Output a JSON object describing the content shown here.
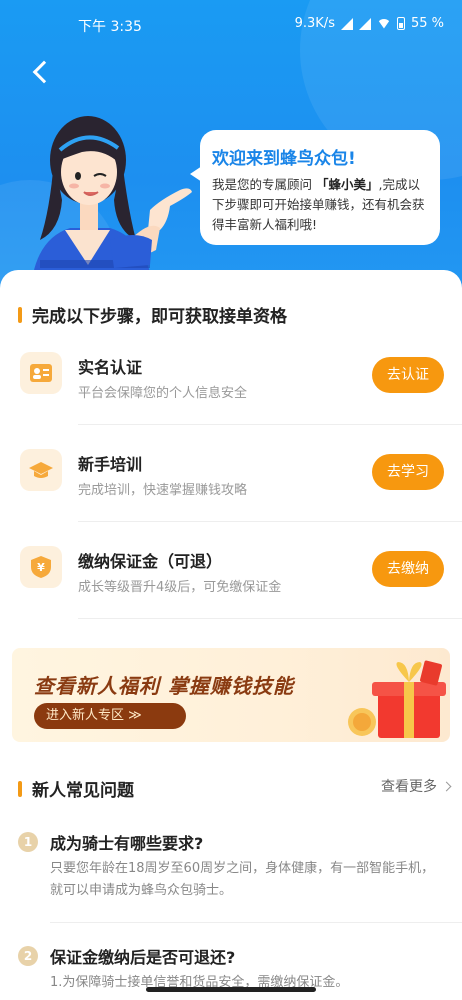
{
  "status_bar": {
    "time": "下午 3:35",
    "net_speed": "9.3K/s",
    "battery": "55 %"
  },
  "welcome": {
    "title": "欢迎来到蜂鸟众包!",
    "line_pre": "我是您的专属顾问 ",
    "advisor": "「蜂小美」",
    "line_post": ",完成以下步骤即可开始接单赚钱，还有机会获得丰富新人福利哦!"
  },
  "steps_section": {
    "title": "完成以下步骤，即可获取接单资格",
    "steps": [
      {
        "name": "实名认证",
        "desc": "平台会保障您的个人信息安全",
        "button": "去认证",
        "icon": "id-card-icon"
      },
      {
        "name": "新手培训",
        "desc": "完成培训，快速掌握赚钱攻略",
        "button": "去学习",
        "icon": "graduation-cap-icon"
      },
      {
        "name": "缴纳保证金（可退）",
        "desc": "成长等级晋升4级后，可免缴保证金",
        "button": "去缴纳",
        "icon": "yuan-shield-icon"
      }
    ]
  },
  "banner": {
    "title": "查看新人福利 掌握赚钱技能",
    "button": "进入新人专区 ≫"
  },
  "faq_section": {
    "title": "新人常见问题",
    "more": "查看更多",
    "items": [
      {
        "num": "1",
        "question": "成为骑士有哪些要求?",
        "answer": "只要您年龄在18周岁至60周岁之间，身体健康，有一部智能手机，就可以申请成为蜂鸟众包骑士。"
      },
      {
        "num": "2",
        "question": "保证金缴纳后是否可退还?",
        "answer": "1.为保障骑士接单信誉和货品安全，需缴纳保证金。"
      }
    ]
  },
  "colors": {
    "hero_blue": "#1d8ff0",
    "accent_orange": "#f7980f",
    "banner_brown": "#8b3a0f"
  }
}
